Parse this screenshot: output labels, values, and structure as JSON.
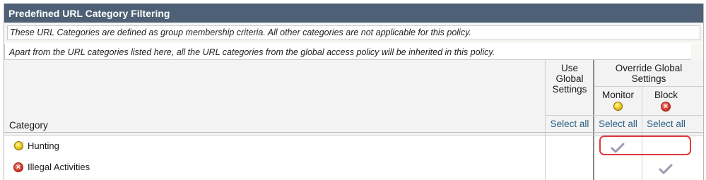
{
  "section": {
    "title": "Predefined URL Category Filtering",
    "note_membership": "These URL Categories are defined as group membership criteria. All other categories are not applicable for this policy.",
    "note_inherit": "Apart from the URL categories listed here, all the URL categories from the global access policy will be inherited in this policy."
  },
  "table": {
    "header": {
      "category": "Category",
      "use_global_line1": "Use",
      "use_global_line2": "Global",
      "use_global_line3": "Settings",
      "override_line1": "Override Global",
      "override_line2": "Settings",
      "monitor": "Monitor",
      "block": "Block",
      "select_all_use_global": "Select all",
      "select_all_monitor": "Select all",
      "select_all_block": "Select all"
    },
    "rows": [
      {
        "name": "Hunting",
        "icon": "monitor-icon",
        "action": "monitor"
      },
      {
        "name": "Illegal Activities",
        "icon": "block-icon",
        "action": "block"
      }
    ]
  },
  "colors": {
    "title_bar": "#4d6075",
    "link": "#2b5c82",
    "highlight": "#e03a3a"
  }
}
